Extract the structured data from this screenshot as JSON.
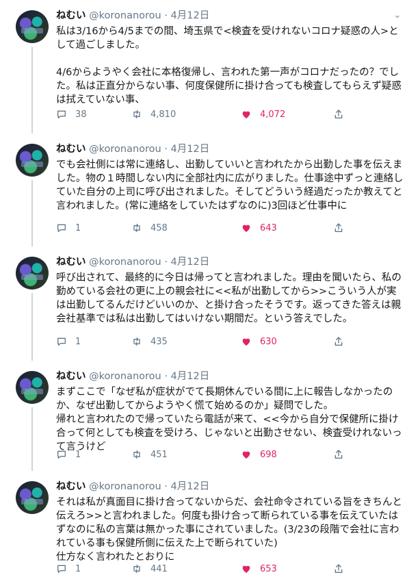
{
  "tweets": [
    {
      "name": "ねむい",
      "handle": "@koronanorou",
      "sep": "·",
      "date": "4月12日",
      "text": "私は3/16から4/5までの間、埼玉県で<検査を受けれないコロナ疑惑の人>として過ごしました。\n\n4/6からようやく会社に本格復帰し、言われた第一声がコロナだったの？でした。私は正直分からない事、何度保健所に掛け合っても検査してもらえず疑惑は拭えていない事、",
      "replies": "38",
      "retweets": "4,810",
      "likes": "4,072"
    },
    {
      "name": "ねむい",
      "handle": "@koronanorou",
      "sep": "·",
      "date": "4月12日",
      "text": "でも会社側には常に連絡し、出勤していいと言われたから出勤した事を伝えました。物の１時間しない内に全部社内に広がりました。仕事途中ずっと連絡していた自分の上司に呼び出されました。そしてどういう経過だったか教えてと言われました。(常に連絡をしていたはずなのに)3回ほど仕事中に",
      "replies": "1",
      "retweets": "458",
      "likes": "643"
    },
    {
      "name": "ねむい",
      "handle": "@koronanorou",
      "sep": "·",
      "date": "4月12日",
      "text": "呼び出されて、最終的に今日は帰ってと言われました。理由を聞いたら、私の勤めている会社の更に上の親会社に<<私が出勤してから>>こういう人が実は出勤してるんだけどいいのか、と掛け合ったそうです。返ってきた答えは親会社基準では私は出勤してはいけない期間だ。という答えでした。",
      "replies": "1",
      "retweets": "435",
      "likes": "630"
    },
    {
      "name": "ねむい",
      "handle": "@koronanorou",
      "sep": "·",
      "date": "4月12日",
      "text": "まずここで「なぜ私が症状がでて長期休んでいる間に上に報告しなかったのか、なぜ出勤してからようやく慌て始めるのか」疑問でした。\n帰れと言われたので帰っていたら電話が来て、<<今から自分で保健所に掛け合って何としても検査を受けろ、じゃないと出勤させない、検査受けれないって言うけど",
      "replies": "1",
      "retweets": "451",
      "likes": "698"
    },
    {
      "name": "ねむい",
      "handle": "@koronanorou",
      "sep": "·",
      "date": "4月12日",
      "text": "それは私が真面目に掛け合ってないからだ、会社命令されている旨をきちんと伝えろ>>と言われました。何度も掛け合って断られている事を伝えていたはずなのに私の言葉は無かった事にされていました。(3/23の段階で会社に言われている事も保健所側に伝えた上で断られていた)\n仕方なく言われたとおりに",
      "replies": "1",
      "retweets": "441",
      "likes": "653"
    }
  ],
  "colors": {
    "like": "#e0245e",
    "muted": "#657786",
    "text": "#14171a"
  },
  "icons": {
    "reply": "reply-icon",
    "retweet": "retweet-icon",
    "like": "heart-icon",
    "share": "share-icon",
    "more": "chevron-down-icon"
  }
}
